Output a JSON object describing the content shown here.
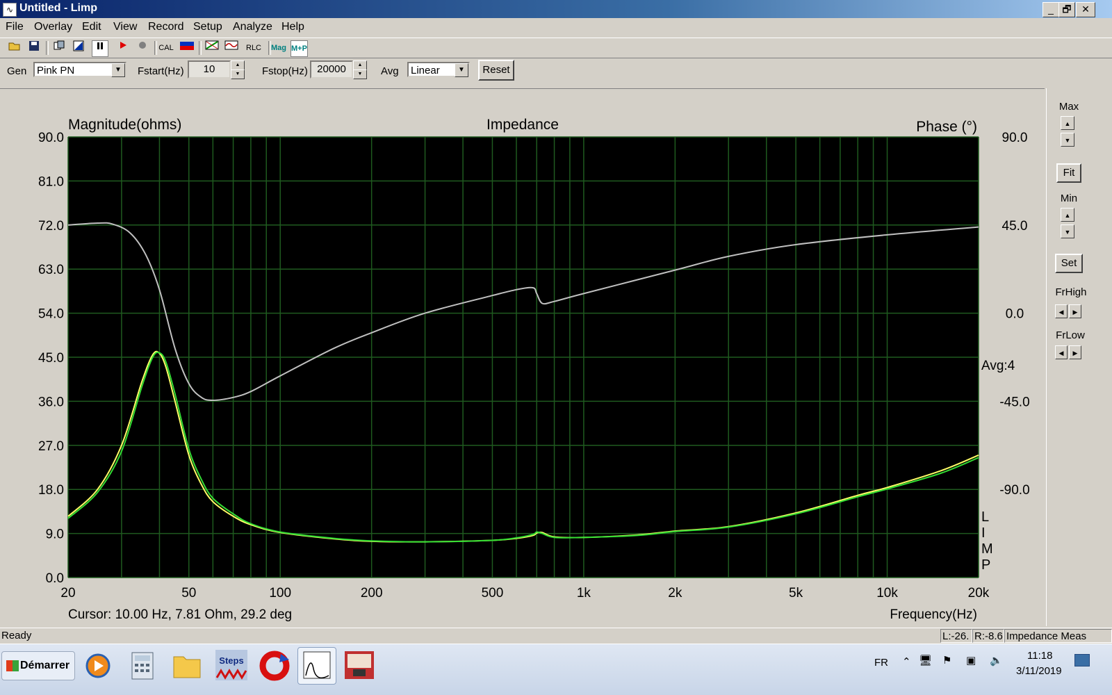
{
  "window": {
    "title": "Untitled - Limp",
    "controls": {
      "minimize": "_",
      "maximize": "🗗",
      "close": "✕"
    }
  },
  "menu": [
    "File",
    "Overlay",
    "Edit",
    "View",
    "Record",
    "Setup",
    "Analyze",
    "Help"
  ],
  "toolbar": {
    "cal_label": "CAL",
    "rlc_label": "RLC",
    "mag_label": "Mag",
    "mp_label": "M+P"
  },
  "controls": {
    "gen_label": "Gen",
    "gen_value": "Pink PN",
    "fstart_label": "Fstart(Hz)",
    "fstart_value": "10",
    "fstop_label": "Fstop(Hz)",
    "fstop_value": "20000",
    "avg_label": "Avg",
    "avg_value": "Linear",
    "reset_label": "Reset"
  },
  "right_panel": {
    "max_label": "Max",
    "fit_label": "Fit",
    "min_label": "Min",
    "set_label": "Set",
    "frhigh_label": "FrHigh",
    "frlow_label": "FrLow"
  },
  "chart_data": {
    "type": "line",
    "title": "Impedance",
    "ylabel": "Magnitude(ohms)",
    "y2label": "Phase (°)",
    "xlabel": "Frequency(Hz)",
    "x_scale": "log",
    "xlim": [
      20,
      20000
    ],
    "ylim": [
      0,
      90
    ],
    "y2lim": [
      -135,
      90
    ],
    "x_ticks": [
      20,
      50,
      100,
      200,
      500,
      1000,
      2000,
      5000,
      10000,
      20000
    ],
    "x_tick_labels": [
      "20",
      "50",
      "100",
      "200",
      "500",
      "1k",
      "2k",
      "5k",
      "10k",
      "20k"
    ],
    "y_ticks": [
      0,
      9,
      18,
      27,
      36,
      45,
      54,
      63,
      72,
      81,
      90
    ],
    "y_tick_labels": [
      "0.0",
      "9.0",
      "18.0",
      "27.0",
      "36.0",
      "45.0",
      "54.0",
      "63.0",
      "72.0",
      "81.0",
      "90.0"
    ],
    "y2_ticks": [
      -90,
      -45,
      0,
      45,
      90
    ],
    "y2_tick_labels": [
      "-90.0",
      "-45.0",
      "0.0",
      "45.0",
      "90.0"
    ],
    "grid": true,
    "background": "#000000",
    "gridcolor": "#1f5a1f",
    "avg_text": "Avg:4",
    "side_letters": [
      "L",
      "I",
      "M",
      "P"
    ],
    "cursor_text": "Cursor: 10.00 Hz, 7.81 Ohm, 29.2 deg",
    "series": [
      {
        "color": "#ffff66",
        "axis": "left",
        "x": [
          20,
          25,
          30,
          35,
          38,
          40,
          42,
          45,
          50,
          55,
          60,
          70,
          80,
          100,
          150,
          200,
          300,
          500,
          600,
          680,
          700,
          730,
          800,
          1000,
          1500,
          2000,
          3000,
          5000,
          8000,
          10000,
          15000,
          20000
        ],
        "y": [
          12.5,
          18,
          27,
          40,
          45.5,
          45.8,
          43,
          36,
          25,
          19,
          15.5,
          12.5,
          10.8,
          9.2,
          7.9,
          7.4,
          7.3,
          7.6,
          8.0,
          8.6,
          9.1,
          9.2,
          8.3,
          8.2,
          8.7,
          9.5,
          10.4,
          13.2,
          16.8,
          18.4,
          21.8,
          25.0
        ]
      },
      {
        "color": "#33dd33",
        "axis": "left",
        "x": [
          20,
          25,
          30,
          35,
          38,
          40,
          42,
          45,
          50,
          55,
          60,
          70,
          80,
          100,
          150,
          200,
          300,
          500,
          600,
          680,
          700,
          730,
          800,
          1000,
          1500,
          2000,
          3000,
          5000,
          8000,
          10000,
          15000,
          20000
        ],
        "y": [
          12.1,
          17.4,
          25.8,
          39,
          45,
          45.9,
          44,
          37.5,
          26.2,
          20,
          16.2,
          13,
          11,
          9.3,
          8.0,
          7.5,
          7.3,
          7.6,
          8.1,
          8.8,
          9.3,
          9.0,
          8.2,
          8.2,
          8.6,
          9.4,
          10.3,
          13.0,
          16.5,
          18.1,
          21.3,
          24.5
        ]
      },
      {
        "color": "#c0c0c0",
        "axis": "right",
        "x": [
          20,
          25,
          28,
          32,
          36,
          40,
          45,
          50,
          55,
          60,
          70,
          80,
          100,
          150,
          200,
          300,
          500,
          600,
          680,
          700,
          730,
          800,
          1000,
          2000,
          3000,
          5000,
          10000,
          20000
        ],
        "y": [
          45,
          46,
          45.5,
          41,
          30,
          12,
          -18,
          -36,
          -43,
          -44.5,
          -43,
          -40,
          -32,
          -18,
          -10,
          0,
          9,
          12,
          13,
          10,
          5,
          6,
          10,
          22,
          29,
          35,
          40,
          44
        ]
      }
    ]
  },
  "statusbar": {
    "ready": "Ready",
    "left_level": "L:-26.",
    "right_level": "R:-8.6",
    "mode": "Impedance Meas"
  },
  "taskbar": {
    "start_label": "Démarrer",
    "steps_label": "Steps",
    "lang": "FR",
    "time": "11:18",
    "date": "3/11/2019"
  }
}
